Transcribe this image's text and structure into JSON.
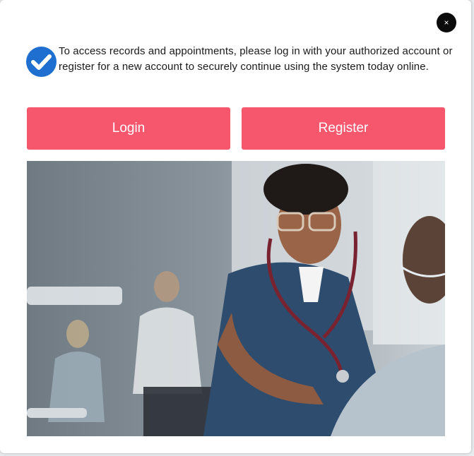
{
  "dialog": {
    "message": "To access records and appointments, please log in with your authorized account or register for a new account to securely continue using the system today online.",
    "close_glyph": "×",
    "icons": {
      "close": "close-icon",
      "status": "check-circle-icon"
    }
  },
  "actions": {
    "login_label": "Login",
    "register_label": "Register"
  },
  "colors": {
    "accent": "#f6576d",
    "check_badge": "#1f6fd1",
    "close_bg": "#0b0b0b"
  }
}
